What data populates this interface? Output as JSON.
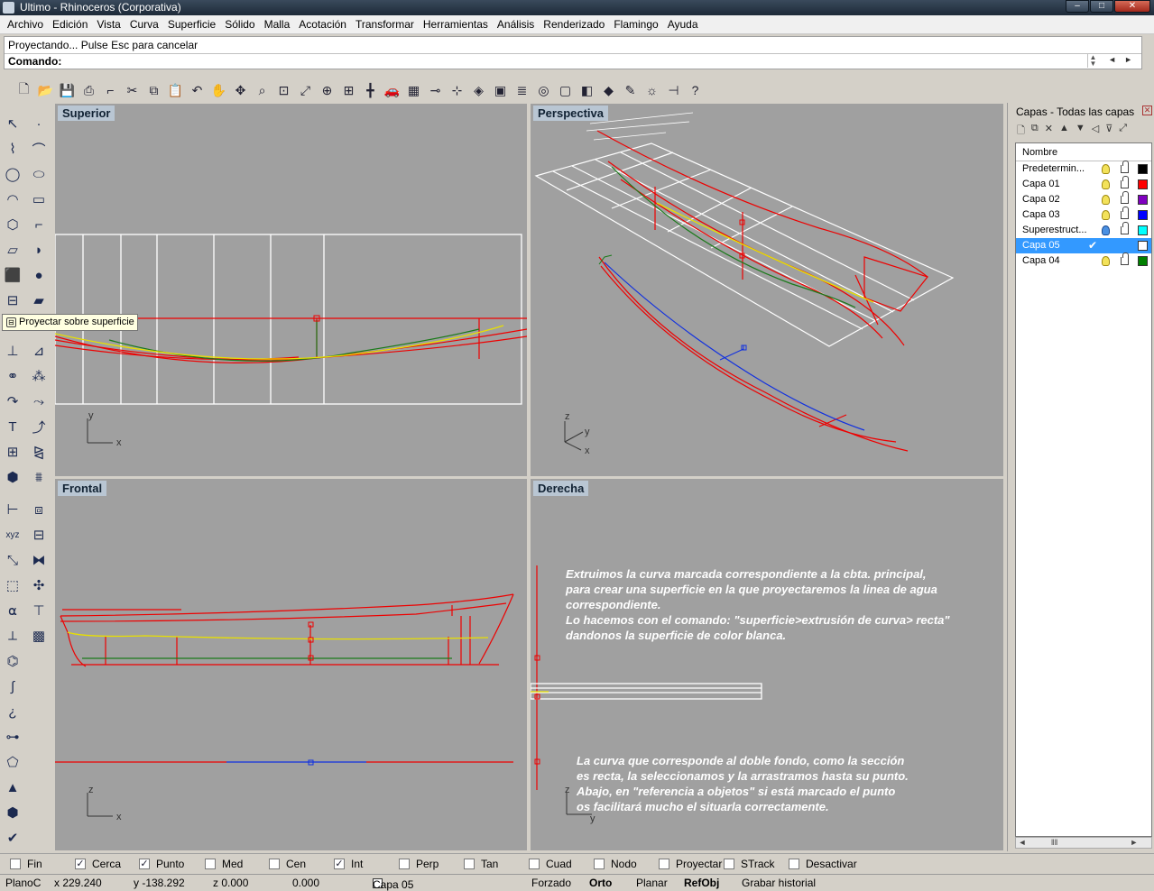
{
  "window": {
    "title": "Ultimo - Rhinoceros (Corporativa)",
    "min": "–",
    "max": "□",
    "close": "✕"
  },
  "menu": [
    "Archivo",
    "Edición",
    "Vista",
    "Curva",
    "Superficie",
    "Sólido",
    "Malla",
    "Acotación",
    "Transformar",
    "Herramientas",
    "Análisis",
    "Renderizado",
    "Flamingo",
    "Ayuda"
  ],
  "command": {
    "history": "Proyectando... Pulse Esc para cancelar",
    "label": "Comando:",
    "value": ""
  },
  "tooltip": "Proyectar sobre superficie",
  "viewports": {
    "top": {
      "label": "Superior",
      "axis_x": "x",
      "axis_y": "y"
    },
    "perspective": {
      "label": "Perspectiva",
      "axis_x": "x",
      "axis_y": "y",
      "axis_z": "z"
    },
    "front": {
      "label": "Frontal",
      "axis_x": "x",
      "axis_z": "z"
    },
    "right": {
      "label": "Derecha",
      "axis_y": "y",
      "axis_z": "z",
      "note1": "Extruimos la curva marcada correspondiente a la cbta. principal,\npara crear una superficie en la que proyectaremos la linea de agua\ncorrespondiente.\nLo hacemos con el comando: \"superficie>extrusión de curva> recta\"\ndandonos la superficie de color blanca.",
      "note2": "La curva que corresponde al doble fondo, como la sección\nes recta, la seleccionamos y la arrastramos hasta su punto.\nAbajo, en \"referencia a objetos\" si está marcado el punto\nos facilitará mucho el situarla correctamente."
    }
  },
  "layers": {
    "title": "Capas - Todas las capas",
    "column": "Nombre",
    "rows": [
      {
        "name": "Predetermin...",
        "color": "#000000",
        "current": false,
        "selected": false,
        "bulb": "on"
      },
      {
        "name": "Capa 01",
        "color": "#ff0000",
        "current": false,
        "selected": false,
        "bulb": "on"
      },
      {
        "name": "Capa 02",
        "color": "#8000c0",
        "current": false,
        "selected": false,
        "bulb": "on"
      },
      {
        "name": "Capa 03",
        "color": "#0000ff",
        "current": false,
        "selected": false,
        "bulb": "on"
      },
      {
        "name": "Superestruct...",
        "color": "#00ffff",
        "current": false,
        "selected": false,
        "bulb": "blue"
      },
      {
        "name": "Capa 05",
        "color": "#ffffff",
        "current": true,
        "selected": true,
        "bulb": "none"
      },
      {
        "name": "Capa 04",
        "color": "#008000",
        "current": false,
        "selected": false,
        "bulb": "on"
      }
    ]
  },
  "osnaps": [
    {
      "label": "Fin",
      "checked": false
    },
    {
      "label": "Cerca",
      "checked": true
    },
    {
      "label": "Punto",
      "checked": true
    },
    {
      "label": "Med",
      "checked": false
    },
    {
      "label": "Cen",
      "checked": false
    },
    {
      "label": "Int",
      "checked": true
    },
    {
      "label": "Perp",
      "checked": false
    },
    {
      "label": "Tan",
      "checked": false
    },
    {
      "label": "Cuad",
      "checked": false
    },
    {
      "label": "Nodo",
      "checked": false
    },
    {
      "label": "Proyectar",
      "checked": false
    },
    {
      "label": "STrack",
      "checked": false
    },
    {
      "label": "Desactivar",
      "checked": false
    }
  ],
  "status": {
    "cplane": "PlanoC",
    "x": "x 229.240",
    "y": "y -138.292",
    "z": "z 0.000",
    "d": "0.000",
    "layer": "Capa 05",
    "forzado": "Forzado",
    "orto": "Orto",
    "planar": "Planar",
    "refobj": "RefObj",
    "history": "Grabar historial"
  }
}
